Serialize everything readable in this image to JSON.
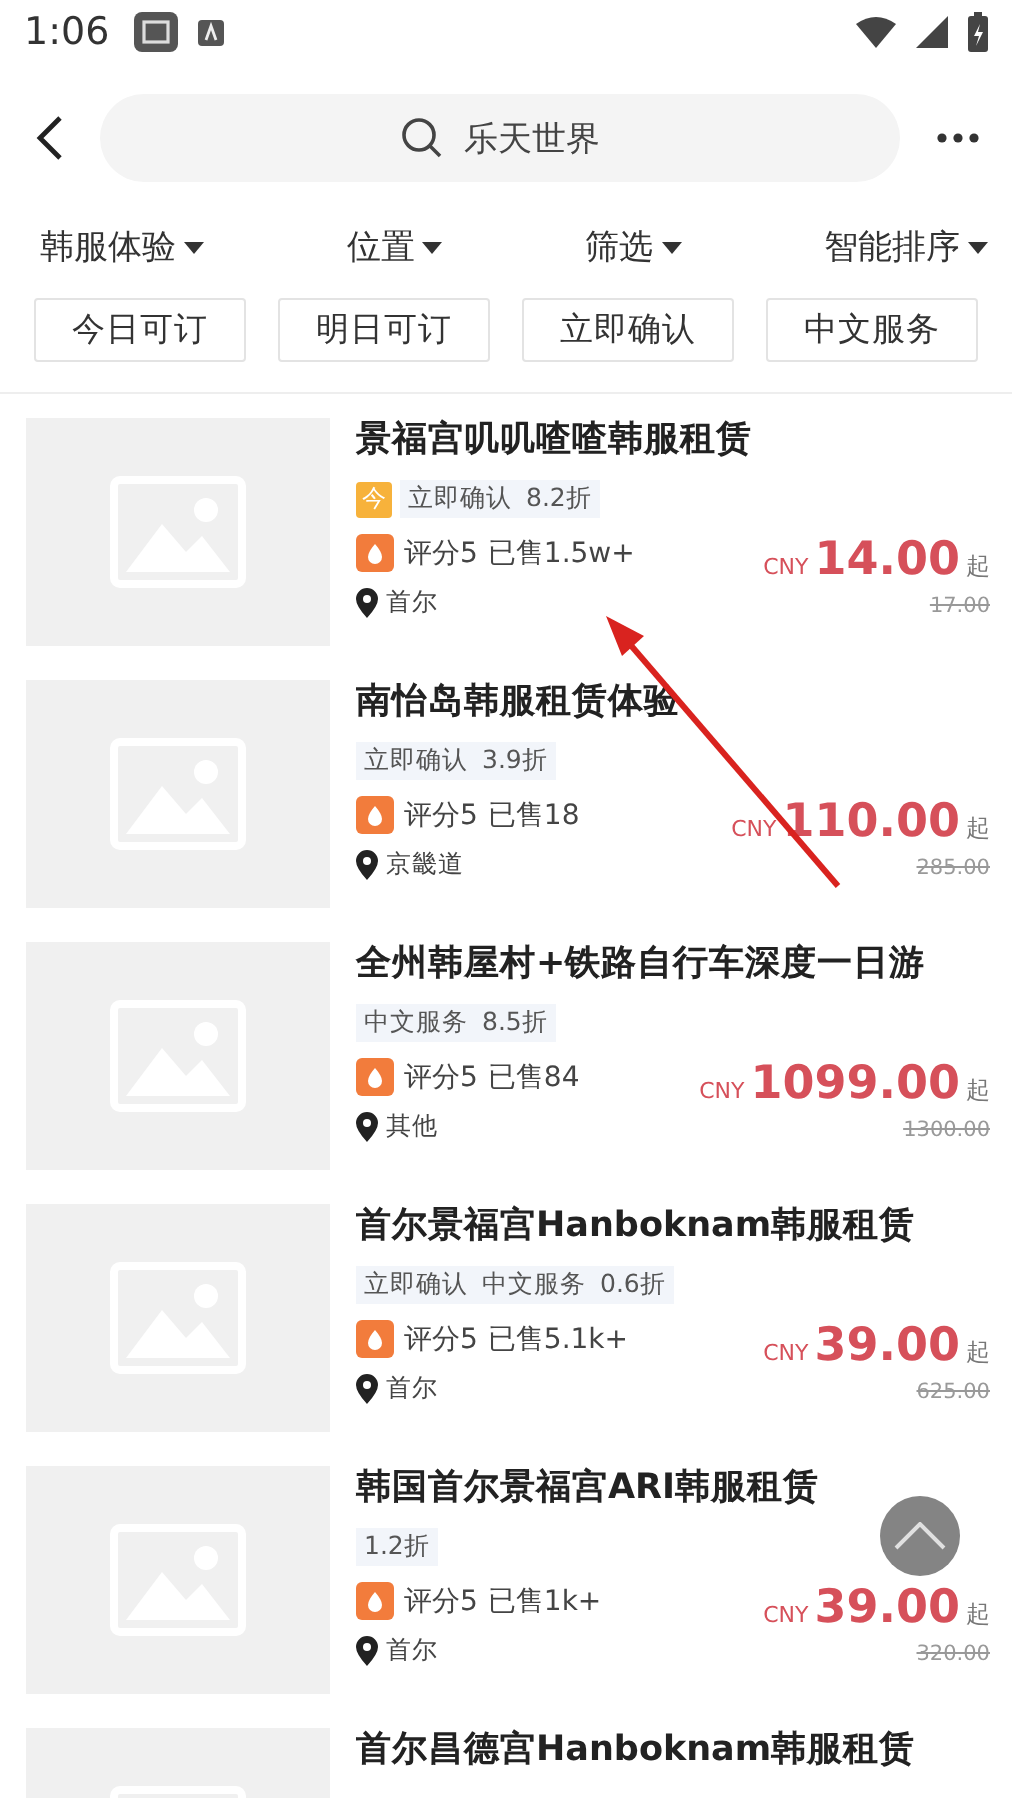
{
  "status_bar": {
    "time": "1:06"
  },
  "search": {
    "value": "乐天世界"
  },
  "filters": [
    {
      "label": "韩服体验"
    },
    {
      "label": "位置"
    },
    {
      "label": "筛选"
    },
    {
      "label": "智能排序"
    }
  ],
  "chips": [
    "今日可订",
    "明日可订",
    "立即确认",
    "中文服务"
  ],
  "items": [
    {
      "title": "景福宫叽叽喳喳韩服租赁",
      "today_badge": "今",
      "tags": [
        "立即确认"
      ],
      "discount": "8.2折",
      "rating": "评分5",
      "sold": "已售1.5w+",
      "location": "首尔",
      "currency": "CNY",
      "price": "14.00",
      "suffix": "起",
      "original_price": "17.00"
    },
    {
      "title": "南怡岛韩服租赁体验",
      "tags": [
        "立即确认"
      ],
      "discount": "3.9折",
      "rating": "评分5",
      "sold": "已售18",
      "location": "京畿道",
      "currency": "CNY",
      "price": "110.00",
      "suffix": "起",
      "original_price": "285.00"
    },
    {
      "title": "全州韩屋村+铁路自行车深度一日游",
      "tags": [
        "中文服务"
      ],
      "discount": "8.5折",
      "rating": "评分5",
      "sold": "已售84",
      "location": "其他",
      "currency": "CNY",
      "price": "1099.00",
      "suffix": "起",
      "original_price": "1300.00"
    },
    {
      "title": "首尔景福宫Hanboknam韩服租赁",
      "tags": [
        "立即确认",
        "中文服务"
      ],
      "discount": "0.6折",
      "rating": "评分5",
      "sold": "已售5.1k+",
      "location": "首尔",
      "currency": "CNY",
      "price": "39.00",
      "suffix": "起",
      "original_price": "625.00"
    },
    {
      "title": "韩国首尔景福宫ARI韩服租赁",
      "discount": "1.2折",
      "rating": "评分5",
      "sold": "已售1k+",
      "location": "首尔",
      "currency": "CNY",
      "price": "39.00",
      "suffix": "起",
      "original_price": "320.00"
    },
    {
      "title": "首尔昌德宫Hanboknam韩服租赁"
    }
  ],
  "scroll_top_button": true,
  "annotation": {
    "kind": "arrow"
  }
}
